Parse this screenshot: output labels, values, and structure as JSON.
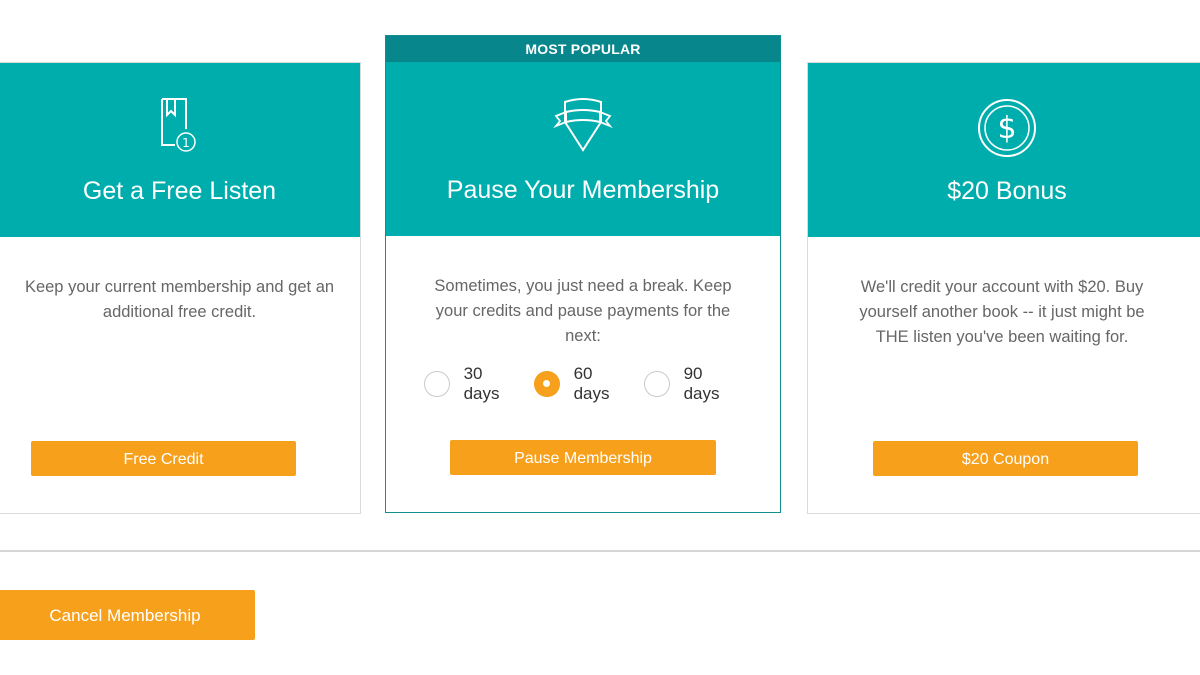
{
  "cards": {
    "free_listen": {
      "icon": "bookmark-credit-icon",
      "title": "Get a Free Listen",
      "description": "Keep your current membership and get an additional free credit.",
      "button_label": "Free Credit"
    },
    "pause": {
      "ribbon": "MOST POPULAR",
      "icon": "shield-banner-icon",
      "title": "Pause Your Membership",
      "description": "Sometimes, you just need a break. Keep your credits and pause payments for the next:",
      "options": [
        {
          "label": "30 days",
          "selected": false
        },
        {
          "label": "60 days",
          "selected": true
        },
        {
          "label": "90 days",
          "selected": false
        }
      ],
      "button_label": "Pause Membership"
    },
    "bonus": {
      "icon": "dollar-coin-icon",
      "title": "$20 Bonus",
      "description": "We'll credit your account with $20. Buy yourself another book -- it just might be THE listen you've been waiting for.",
      "button_label": "$20 Coupon"
    }
  },
  "footer": {
    "cancel_label": "Cancel Membership"
  },
  "colors": {
    "teal": "#00adad",
    "teal_dark": "#07878c",
    "orange": "#f7a01c"
  }
}
